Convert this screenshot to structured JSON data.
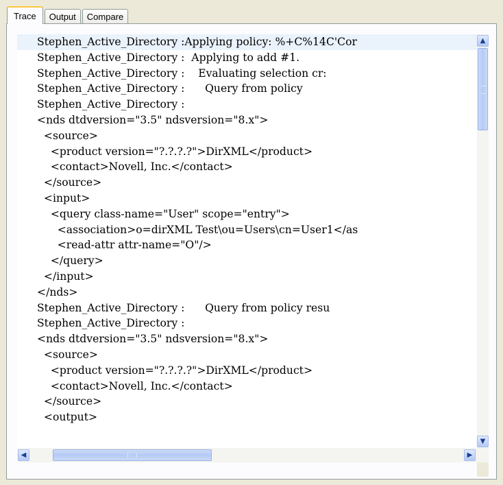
{
  "tabs": [
    {
      "label": "Trace"
    },
    {
      "label": "Output"
    },
    {
      "label": "Compare"
    }
  ],
  "trace_lines": [
    "Stephen_Active_Directory :Applying policy: %+C%14C'Cor",
    "Stephen_Active_Directory :  Applying to add #1.",
    "Stephen_Active_Directory :    Evaluating selection cr:",
    "Stephen_Active_Directory :      Query from policy",
    "Stephen_Active_Directory :",
    "<nds dtdversion=\"3.5\" ndsversion=\"8.x\">",
    "  <source>",
    "    <product version=\"?.?.?.?\">DirXML</product>",
    "    <contact>Novell, Inc.</contact>",
    "  </source>",
    "  <input>",
    "    <query class-name=\"User\" scope=\"entry\">",
    "      <association>o=dirXML Test\\ou=Users\\cn=User1</as",
    "      <read-attr attr-name=\"O\"/>",
    "    </query>",
    "  </input>",
    "</nds>",
    "Stephen_Active_Directory :      Query from policy resu",
    "Stephen_Active_Directory :",
    "<nds dtdversion=\"3.5\" ndsversion=\"8.x\">",
    "  <source>",
    "    <product version=\"?.?.?.?\">DirXML</product>",
    "    <contact>Novell, Inc.</contact>",
    "  </source>",
    "  <output>"
  ],
  "icons": {
    "scroll_up": "scroll-up-arrow-icon",
    "scroll_down": "scroll-down-arrow-icon",
    "scroll_left": "scroll-left-arrow-icon",
    "scroll_right": "scroll-right-arrow-icon"
  },
  "colors": {
    "active_tab_accent": "#ffc73c",
    "selected_line": "#eaf2fb",
    "scrollbar_thumb": "#b5cbf5"
  }
}
